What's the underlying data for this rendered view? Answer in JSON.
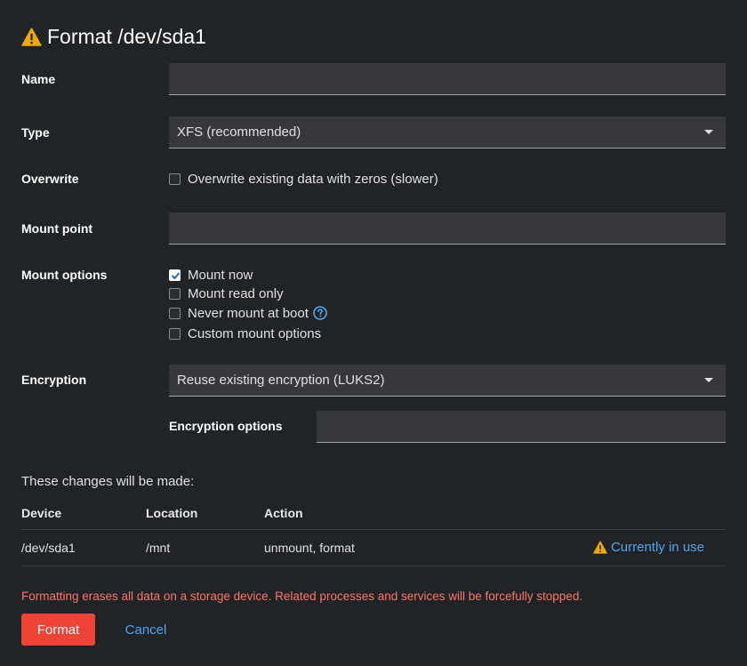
{
  "dialog": {
    "title": "Format /dev/sda1"
  },
  "form": {
    "name": {
      "label": "Name",
      "value": ""
    },
    "type": {
      "label": "Type",
      "value": "XFS (recommended)"
    },
    "overwrite": {
      "label": "Overwrite",
      "option": "Overwrite existing data with zeros (slower)",
      "checked": false
    },
    "mount_point": {
      "label": "Mount point",
      "value": ""
    },
    "mount_options": {
      "label": "Mount options",
      "items": [
        {
          "label": "Mount now",
          "checked": true
        },
        {
          "label": "Mount read only",
          "checked": false
        },
        {
          "label": "Never mount at boot",
          "checked": false,
          "help_icon": "question-circle-icon"
        },
        {
          "label": "Custom mount options",
          "checked": false
        }
      ]
    },
    "encryption": {
      "label": "Encryption",
      "value": "Reuse existing encryption (LUKS2)"
    },
    "encryption_options": {
      "label": "Encryption options",
      "value": ""
    }
  },
  "changes": {
    "title": "These changes will be made:",
    "columns": [
      "Device",
      "Location",
      "Action"
    ],
    "rows": [
      {
        "device": "/dev/sda1",
        "location": "/mnt",
        "action": "unmount, format",
        "status": "Currently in use",
        "status_icon": "warning-icon"
      }
    ]
  },
  "warning_text": "Formatting erases all data on a storage device. Related processes and services will be forcefully stopped.",
  "buttons": {
    "format": "Format",
    "cancel": "Cancel"
  },
  "colors": {
    "background": "#212427",
    "danger": "#ee4436",
    "link": "#4aa8ef",
    "warning": "#f0ab00"
  }
}
